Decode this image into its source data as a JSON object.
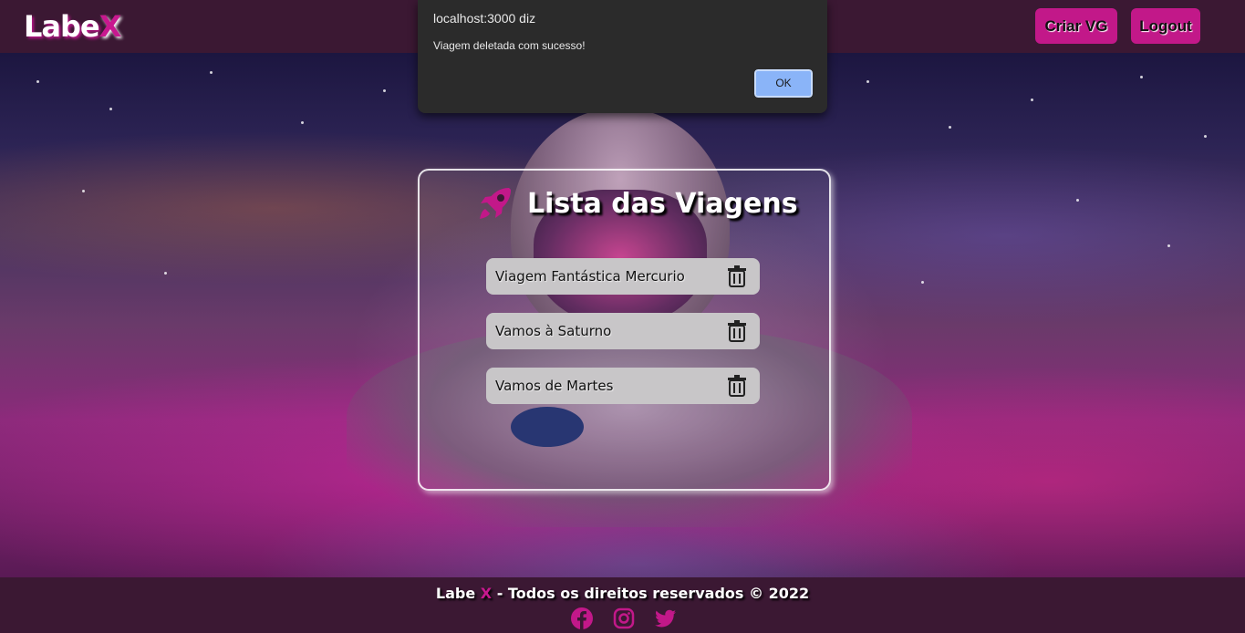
{
  "header": {
    "logo_main": "Labe",
    "logo_accent": "X",
    "buttons": {
      "create": "Criar VG",
      "logout": "Logout"
    }
  },
  "dialog": {
    "title": "localhost:3000 diz",
    "message": "Viagem deletada com sucesso!",
    "ok_label": "OK"
  },
  "main": {
    "title": "Lista das Viagens",
    "trips": [
      {
        "name": "Viagem Fantástica Mercurio"
      },
      {
        "name": "Vamos à Saturno"
      },
      {
        "name": "Vamos de Martes"
      }
    ]
  },
  "footer": {
    "brand": "Labe",
    "brand_accent": "X",
    "rights": "- Todos os direitos reservados © 2022",
    "socials": [
      "facebook-icon",
      "instagram-icon",
      "twitter-icon"
    ]
  },
  "colors": {
    "header_bg": "#3b1833",
    "accent": "#c21889",
    "dialog_bg": "#2b2b2b",
    "ok_button": "#8ab4f8",
    "trip_bg": "#c8c6c8"
  }
}
